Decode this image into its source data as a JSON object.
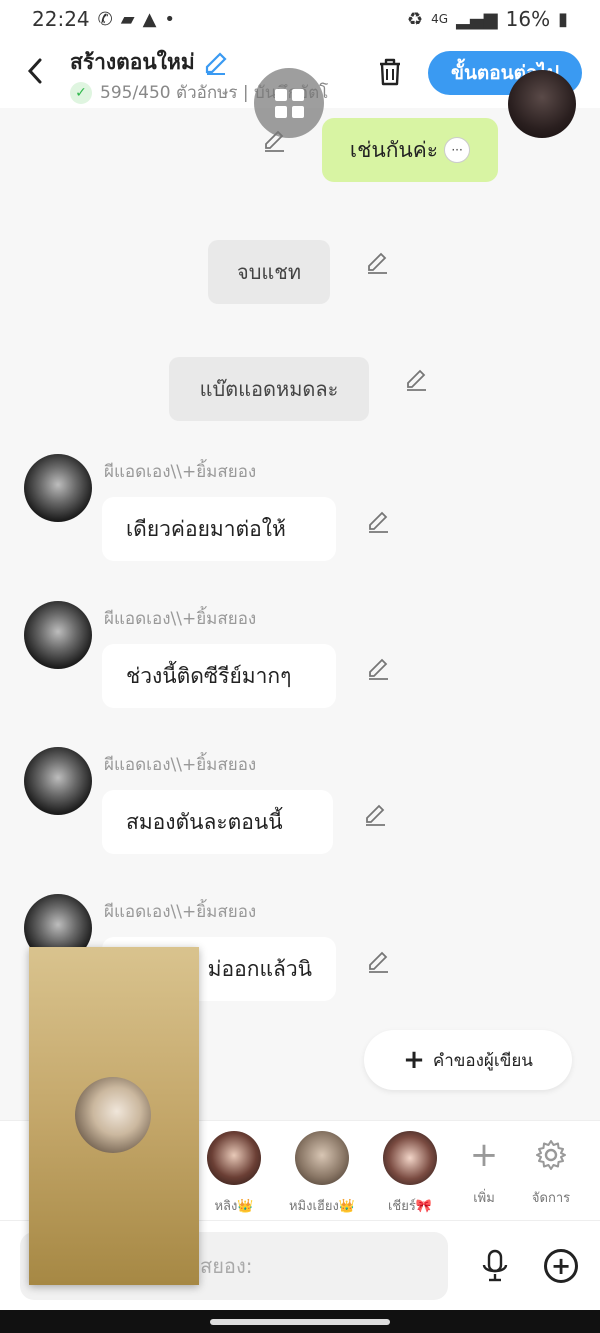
{
  "status": {
    "time": "22:24",
    "battery": "16%",
    "network": "4G"
  },
  "header": {
    "title": "สร้างตอนใหม่",
    "subtitle": "595/450 ตัวอักษร | บันทึกอัตโ",
    "next_label": "ขั้นตอนต่อไป"
  },
  "messages": {
    "green_text": "เช่นกันค่ะ",
    "narration1": "จบแชท",
    "narration2": "แบ๊ตแอดหมดละ",
    "speaker_name": "ผีแอดเอง\\\\+ยิ้มสยอง",
    "msg1": "เดียวค่อยมาต่อให้",
    "msg2": "ช่วงนี้ติดซีรีย์มากๆ",
    "msg3": "สมองตันละตอนนี้",
    "msg4": "ม่ออกแล้วนิ"
  },
  "author_button": "คำของผู้เขียน",
  "characters": [
    {
      "name": "หลิง👑"
    },
    {
      "name": "หมิงเฮียง👑"
    },
    {
      "name": "เชียร์🎀"
    }
  ],
  "tools": {
    "add_label": "เพิ่ม",
    "manage_label": "จัดการ"
  },
  "input": {
    "placeholder": "สยอง:"
  }
}
